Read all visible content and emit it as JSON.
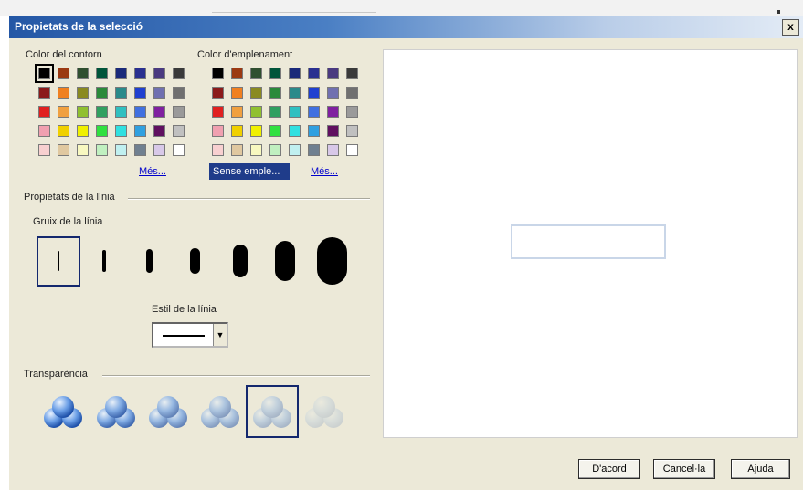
{
  "dialog": {
    "title": "Propietats de la selecció",
    "close_label": "x"
  },
  "outline": {
    "label": "Color del contorn",
    "more_label": "Més...",
    "selected": "#000000",
    "colors": [
      "#000000",
      "#9b3a12",
      "#2f4f2f",
      "#00553a",
      "#1a2a7a",
      "#2a3090",
      "#4a3a80",
      "#3a3a3a",
      "#8b1a1a",
      "#f08020",
      "#8a8a20",
      "#2a8a3a",
      "#2a8a8a",
      "#2040d0",
      "#7070b0",
      "#707070",
      "#e02020",
      "#f0a040",
      "#90c030",
      "#30a060",
      "#30c0c0",
      "#4070e0",
      "#8020a0",
      "#9a9a9a",
      "#f0a0b0",
      "#f0d000",
      "#f0f000",
      "#30e040",
      "#30e0e0",
      "#30a0e0",
      "#601060",
      "#c0c0c0",
      "#f8d0d0",
      "#e0c8a0",
      "#f8f8c0",
      "#c0f0c0",
      "#c0f0f0",
      "#708090",
      "#d8c8e8",
      "#ffffff"
    ]
  },
  "fill": {
    "label": "Color d'emplenament",
    "no_fill_label": "Sense emple...",
    "more_label": "Més...",
    "colors": [
      "#000000",
      "#9b3a12",
      "#2f4f2f",
      "#00553a",
      "#1a2a7a",
      "#2a3090",
      "#4a3a80",
      "#3a3a3a",
      "#8b1a1a",
      "#f08020",
      "#8a8a20",
      "#2a8a3a",
      "#2a8a8a",
      "#2040d0",
      "#7070b0",
      "#707070",
      "#e02020",
      "#f0a040",
      "#90c030",
      "#30a060",
      "#30c0c0",
      "#4070e0",
      "#8020a0",
      "#9a9a9a",
      "#f0a0b0",
      "#f0d000",
      "#f0f000",
      "#30e040",
      "#30e0e0",
      "#30a0e0",
      "#601060",
      "#c0c0c0",
      "#f8d0d0",
      "#e0c8a0",
      "#f8f8c0",
      "#c0f0c0",
      "#c0f0f0",
      "#708090",
      "#d8c8e8",
      "#ffffff"
    ]
  },
  "line_props": {
    "label": "Propietats de la línia",
    "thickness_label": "Gruix de la línia",
    "thickness_levels": [
      1,
      2,
      3,
      4,
      5,
      6,
      7
    ],
    "selected_thickness": 1,
    "style_label": "Estil de la línia",
    "style_value": "solid"
  },
  "transparency": {
    "label": "Transparència",
    "levels": [
      0,
      20,
      40,
      60,
      80,
      100
    ],
    "selected_index": 4
  },
  "buttons": {
    "ok": "D'acord",
    "cancel": "Cancel·la",
    "help": "Ajuda"
  }
}
